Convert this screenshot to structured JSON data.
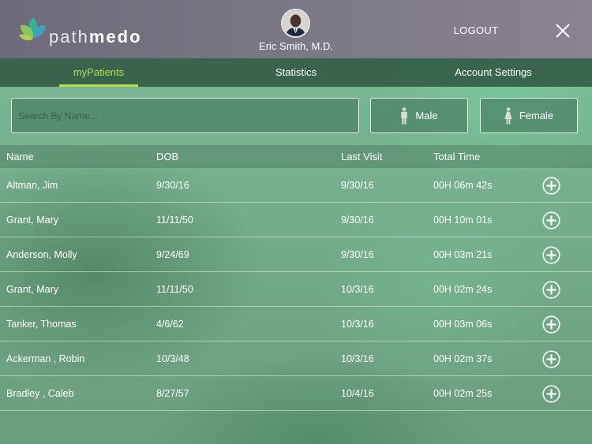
{
  "brand": {
    "part1": "path",
    "part2": "medo"
  },
  "doctor": {
    "name": "Eric Smith, M.D."
  },
  "header": {
    "logout_label": "LOGOUT"
  },
  "tabs": [
    {
      "label": "myPatients",
      "active": true
    },
    {
      "label": "Statistics",
      "active": false
    },
    {
      "label": "Account Settings",
      "active": false
    }
  ],
  "search": {
    "placeholder": "Search By Name..."
  },
  "filters": {
    "male_label": "Male",
    "female_label": "Female"
  },
  "table": {
    "columns": [
      "Name",
      "DOB",
      "Last Visit",
      "Total Time"
    ],
    "rows": [
      {
        "name": "Altman, Jim",
        "dob": "9/30/16",
        "last_visit": "9/30/16",
        "total_time": "00H 06m 42s"
      },
      {
        "name": "Grant, Mary",
        "dob": "11/11/50",
        "last_visit": "9/30/16",
        "total_time": "00H 10m 01s"
      },
      {
        "name": "Anderson, Molly",
        "dob": "9/24/69",
        "last_visit": "9/30/16",
        "total_time": "00H 03m 21s"
      },
      {
        "name": "Grant, Mary",
        "dob": "11/11/50",
        "last_visit": "10/3/16",
        "total_time": "00H 02m 24s"
      },
      {
        "name": "Tanker, Thomas",
        "dob": "4/6/62",
        "last_visit": "10/3/16",
        "total_time": "00H 03m 06s"
      },
      {
        "name": "Ackerman , Robin",
        "dob": "10/3/48",
        "last_visit": "10/3/16",
        "total_time": "00H 02m 37s"
      },
      {
        "name": "Bradley , Caleb",
        "dob": "8/27/57",
        "last_visit": "10/4/16",
        "total_time": "00H 02m 25s"
      }
    ]
  },
  "colors": {
    "accent": "#b5e04a",
    "tab_bar": "#2c4a3a",
    "header": "#76727f"
  },
  "icons": {
    "logo": "lotus-logo-icon",
    "close": "close-icon",
    "add": "add-circle-icon",
    "male": "male-icon",
    "female": "female-icon"
  }
}
